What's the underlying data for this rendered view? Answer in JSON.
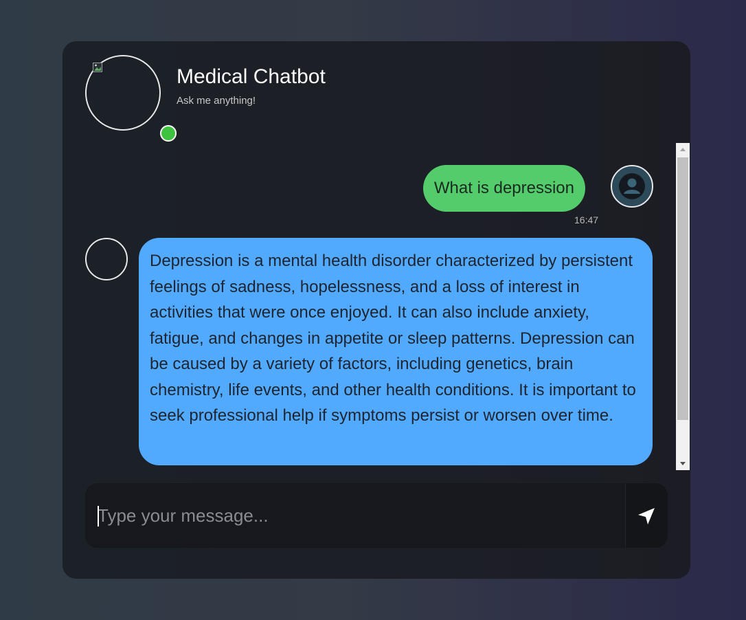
{
  "header": {
    "title": "Medical Chatbot",
    "subtitle": "Ask me anything!",
    "logo_icon": "broken-image-icon",
    "status_color": "#3fc23f"
  },
  "messages": [
    {
      "role": "user",
      "text": "What is depression",
      "time": "16:47",
      "avatar_icon": "user-icon"
    },
    {
      "role": "bot",
      "text": "Depression is a mental health disorder characterized by persistent feelings of sadness, hopelessness, and a loss of interest in activities that were once enjoyed. It can also include anxiety, fatigue, and changes in appetite or sleep patterns. Depression can be caused by a variety of factors, including genetics, brain chemistry, life events, and other health conditions. It is important to seek professional help if symptoms persist or worsen over time."
    }
  ],
  "composer": {
    "placeholder": "Type your message...",
    "value": "",
    "send_icon": "send-arrow-icon"
  },
  "colors": {
    "user_bubble": "#54cc6c",
    "bot_bubble": "#52aaff",
    "card_bg": "#1c2027"
  }
}
